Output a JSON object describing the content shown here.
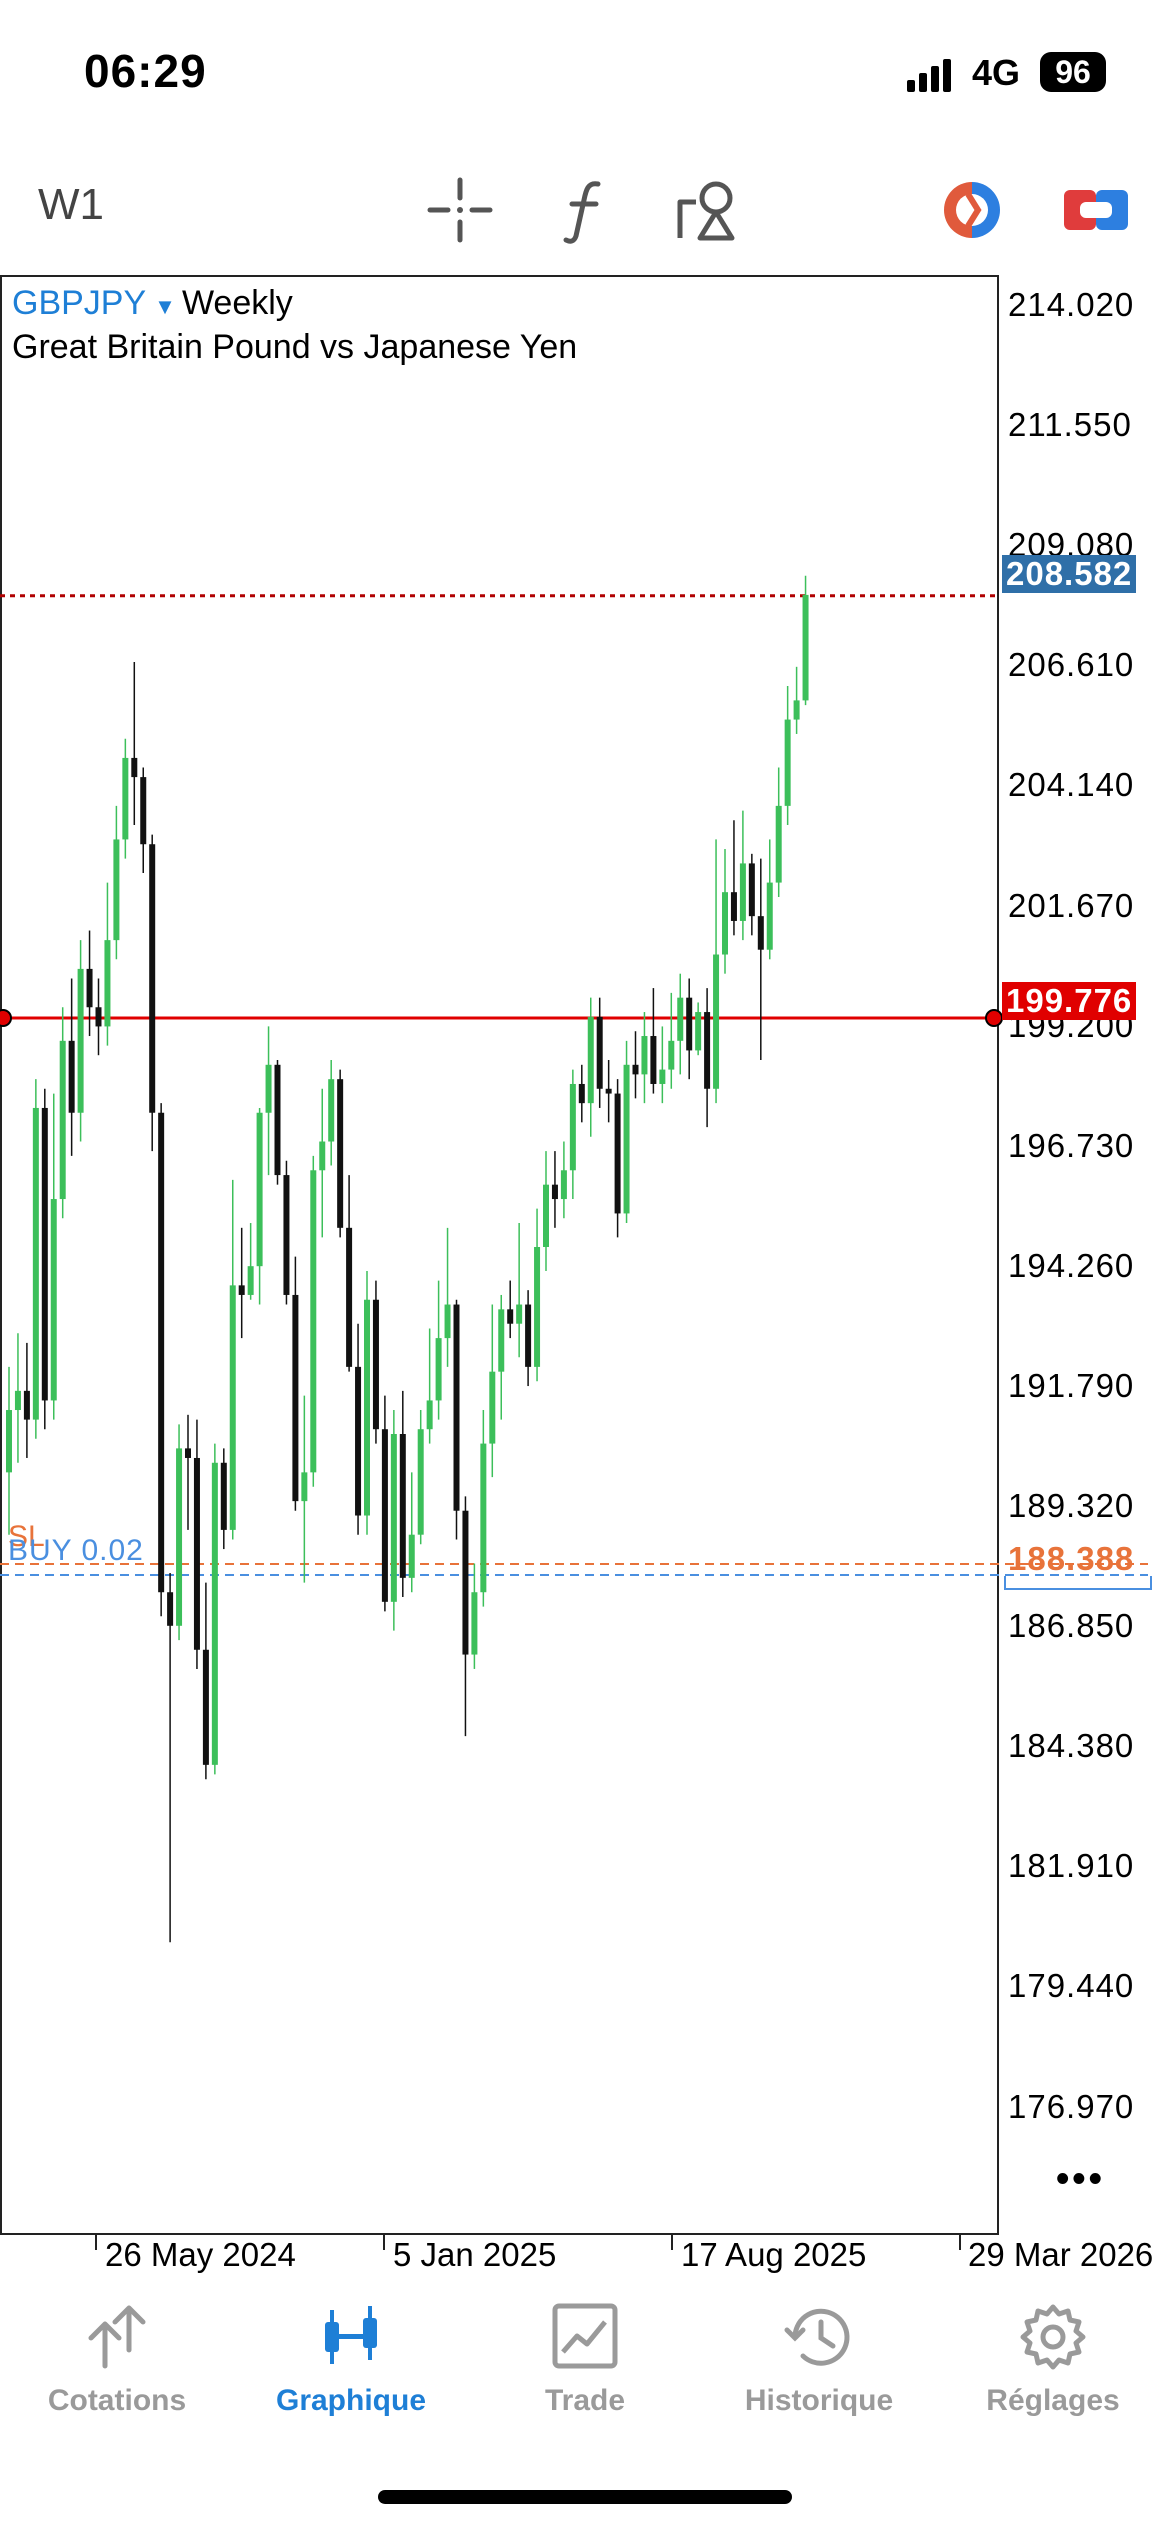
{
  "status_bar": {
    "time": "06:29",
    "network": "4G",
    "battery": "96"
  },
  "toolbar": {
    "timeframe": "W1",
    "icons": [
      "crosshair-icon",
      "function-icon",
      "drawing-tools-icon",
      "one-click-trading-icon",
      "trade-panel-icon"
    ]
  },
  "chart": {
    "symbol": "GBPJPY",
    "period": "Weekly",
    "description": "Great Britain Pound vs Japanese Yen",
    "price_scale": [
      "214.020",
      "211.550",
      "209.080",
      "206.610",
      "204.140",
      "201.670",
      "199.200",
      "196.730",
      "194.260",
      "191.790",
      "189.320",
      "186.850",
      "184.380",
      "181.910",
      "179.440",
      "176.970"
    ],
    "current_price": "208.582",
    "alert_price": "199.776",
    "sl_price": "188.388",
    "sl_label": "SL",
    "position_label": "BUY 0.02",
    "date_labels": [
      "26 May 2024",
      "5 Jan 2025",
      "17 Aug 2025",
      "29 Mar 2026"
    ],
    "more_label": "•••",
    "colors": {
      "bull": "#3cbf5a",
      "bear": "#111111",
      "current_line": "#b00000",
      "alert_line": "#e00000",
      "sl": "#e8733a",
      "buy": "#4a8fe0",
      "accent": "#1e7fd6"
    }
  },
  "chart_data": {
    "type": "candlestick",
    "y_range": [
      175.5,
      214.5
    ],
    "candles": [
      [
        190.3,
        191.6,
        189.0,
        192.5
      ],
      [
        191.6,
        192.0,
        190.5,
        193.2
      ],
      [
        192.0,
        191.4,
        190.6,
        193.0
      ],
      [
        191.4,
        197.9,
        191.0,
        198.5
      ],
      [
        197.9,
        191.8,
        191.2,
        198.3
      ],
      [
        191.8,
        196.0,
        191.4,
        198.2
      ],
      [
        196.0,
        199.3,
        195.6,
        200.0
      ],
      [
        199.3,
        197.8,
        196.9,
        200.6
      ],
      [
        197.8,
        200.8,
        197.2,
        201.4
      ],
      [
        200.8,
        200.0,
        199.4,
        201.6
      ],
      [
        200.0,
        199.6,
        199.0,
        200.6
      ],
      [
        199.6,
        201.4,
        199.2,
        202.6
      ],
      [
        201.4,
        203.5,
        201.0,
        204.2
      ],
      [
        203.5,
        205.2,
        203.1,
        205.6
      ],
      [
        205.2,
        204.8,
        203.8,
        207.2
      ],
      [
        204.8,
        203.4,
        202.8,
        205.0
      ],
      [
        203.4,
        197.8,
        197.0,
        203.6
      ],
      [
        197.8,
        187.8,
        187.3,
        198.0
      ],
      [
        187.8,
        187.1,
        180.5,
        188.2
      ],
      [
        187.1,
        190.8,
        186.8,
        191.3
      ],
      [
        190.8,
        190.6,
        189.1,
        191.5
      ],
      [
        190.6,
        186.6,
        186.2,
        191.4
      ],
      [
        186.6,
        184.2,
        183.9,
        188.0
      ],
      [
        184.2,
        190.5,
        184.0,
        190.9
      ],
      [
        190.5,
        189.1,
        188.7,
        190.8
      ],
      [
        189.1,
        194.2,
        188.9,
        196.4
      ],
      [
        194.2,
        194.0,
        193.1,
        195.4
      ],
      [
        194.0,
        194.6,
        193.9,
        195.5
      ],
      [
        194.6,
        197.8,
        193.8,
        197.9
      ],
      [
        197.8,
        198.8,
        196.5,
        199.6
      ],
      [
        198.8,
        196.5,
        196.3,
        198.9
      ],
      [
        196.5,
        194.0,
        193.8,
        196.8
      ],
      [
        194.0,
        189.7,
        189.5,
        194.8
      ],
      [
        189.7,
        190.3,
        188.0,
        191.9
      ],
      [
        190.3,
        196.6,
        190.0,
        196.9
      ],
      [
        196.6,
        197.2,
        195.2,
        198.3
      ],
      [
        197.2,
        198.5,
        196.7,
        198.9
      ],
      [
        198.5,
        195.4,
        195.2,
        198.7
      ],
      [
        195.4,
        192.5,
        192.4,
        196.5
      ],
      [
        192.5,
        189.4,
        189.0,
        193.4
      ],
      [
        189.4,
        193.9,
        189.0,
        194.5
      ],
      [
        193.9,
        191.2,
        190.9,
        194.3
      ],
      [
        191.2,
        187.6,
        187.4,
        191.9
      ],
      [
        187.6,
        191.1,
        187.0,
        191.6
      ],
      [
        191.1,
        188.1,
        187.7,
        192.0
      ],
      [
        188.1,
        189.0,
        187.8,
        190.3
      ],
      [
        189.0,
        191.2,
        188.8,
        191.6
      ],
      [
        191.2,
        191.8,
        190.9,
        193.3
      ],
      [
        191.8,
        193.1,
        191.4,
        194.3
      ],
      [
        193.1,
        193.8,
        192.5,
        195.4
      ],
      [
        193.8,
        189.5,
        188.9,
        193.9
      ],
      [
        189.5,
        186.5,
        184.8,
        189.8
      ],
      [
        186.5,
        187.8,
        186.2,
        188.4
      ],
      [
        187.8,
        190.9,
        187.5,
        191.6
      ],
      [
        190.9,
        192.4,
        190.2,
        193.8
      ],
      [
        192.4,
        193.7,
        191.4,
        194.0
      ],
      [
        193.7,
        193.4,
        193.1,
        194.3
      ],
      [
        193.4,
        193.8,
        192.7,
        195.5
      ],
      [
        193.8,
        192.5,
        192.1,
        194.1
      ],
      [
        192.5,
        195.0,
        192.2,
        195.8
      ],
      [
        195.0,
        196.3,
        194.5,
        197.0
      ],
      [
        196.3,
        196.0,
        195.4,
        197.0
      ],
      [
        196.0,
        196.6,
        195.6,
        197.2
      ],
      [
        196.6,
        198.4,
        196.0,
        198.7
      ],
      [
        198.4,
        198.0,
        197.6,
        198.8
      ],
      [
        198.0,
        199.8,
        197.3,
        200.2
      ],
      [
        199.8,
        198.3,
        197.9,
        200.2
      ],
      [
        198.3,
        198.2,
        197.6,
        198.9
      ],
      [
        198.2,
        195.7,
        195.2,
        198.5
      ],
      [
        195.7,
        198.8,
        195.5,
        199.3
      ],
      [
        198.8,
        198.6,
        198.1,
        199.5
      ],
      [
        198.6,
        199.4,
        198.0,
        199.9
      ],
      [
        199.4,
        198.4,
        198.2,
        200.4
      ],
      [
        198.4,
        198.7,
        198.0,
        199.6
      ],
      [
        198.7,
        199.3,
        198.3,
        200.3
      ],
      [
        199.3,
        200.2,
        198.6,
        200.7
      ],
      [
        200.2,
        199.1,
        198.5,
        200.6
      ],
      [
        199.1,
        199.9,
        199.0,
        200.1
      ],
      [
        199.9,
        198.3,
        197.5,
        200.4
      ],
      [
        198.3,
        201.1,
        198.0,
        203.5
      ],
      [
        201.1,
        202.4,
        200.7,
        203.3
      ],
      [
        202.4,
        201.8,
        201.5,
        203.9
      ],
      [
        201.8,
        203.0,
        201.4,
        204.1
      ],
      [
        203.0,
        201.9,
        201.5,
        203.2
      ],
      [
        201.9,
        201.2,
        198.9,
        203.1
      ],
      [
        201.2,
        202.6,
        201.0,
        203.5
      ],
      [
        202.6,
        204.2,
        202.3,
        205.0
      ],
      [
        204.2,
        206.0,
        203.8,
        206.7
      ],
      [
        206.0,
        206.4,
        205.7,
        207.1
      ],
      [
        206.4,
        208.6,
        206.3,
        209.0
      ]
    ]
  }
}
